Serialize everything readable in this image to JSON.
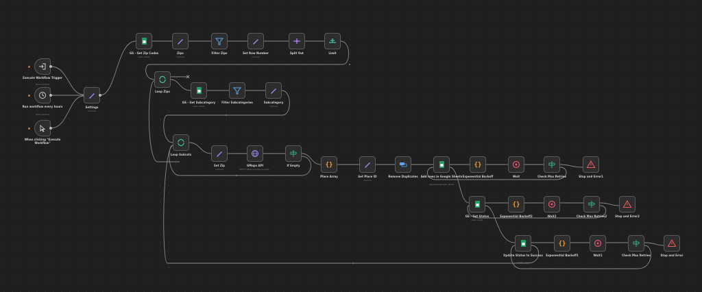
{
  "colors": {
    "background": "#1f1f1f",
    "node_fill": "#2d2d2d",
    "node_border": "#5a5a5a",
    "wire": "#8a8a8a",
    "sheets_green": "#1fa463",
    "edit_purple": "#9b8cf5",
    "filter_blue": "#5aa9f0",
    "split_purple": "#b27bf0",
    "limit_teal": "#41c4a6",
    "code_orange": "#f0a12f",
    "wait_red": "#e8556e",
    "if_green": "#36b37e",
    "error_red": "#ea5b5b",
    "trigger_dot": "#e0683b"
  },
  "nodes": [
    {
      "id": "execute-workflow-trigger",
      "label": "Execute Workflow Trigger",
      "sub": "(Deactivated)",
      "icon": "sign-in-icon",
      "trigger": true
    },
    {
      "id": "run-every-hours",
      "label": "Run workflow every hours",
      "sub": "(Deactivated)",
      "icon": "clock-icon",
      "trigger": true
    },
    {
      "id": "when-clicking-execute",
      "label": "When clicking \"Execute Workflow\"",
      "sub": "",
      "icon": "cursor-icon",
      "trigger": true
    },
    {
      "id": "settings",
      "label": "Settings",
      "sub": "manual",
      "icon": "pencil-icon"
    },
    {
      "id": "gs-get-zip-codes",
      "label": "GS - Get Zip Codes",
      "sub": "read: sheet",
      "icon": "sheets-icon"
    },
    {
      "id": "zips",
      "label": "Zips",
      "sub": "manual",
      "icon": "pencil-icon"
    },
    {
      "id": "filter-zips",
      "label": "Filter Zips",
      "sub": "",
      "icon": "filter-icon"
    },
    {
      "id": "set-row-number",
      "label": "Set Row Number",
      "sub": "manual",
      "icon": "pencil-icon"
    },
    {
      "id": "split-out",
      "label": "Split Out",
      "sub": "",
      "icon": "split-icon"
    },
    {
      "id": "limit",
      "label": "Limit",
      "sub": "",
      "icon": "limit-icon"
    },
    {
      "id": "loop-zips",
      "label": "Loop Zips",
      "sub": "",
      "icon": "loop-icon"
    },
    {
      "id": "gs-get-subcategory",
      "label": "GS - Get Subcategory",
      "sub": "read: sheet",
      "icon": "sheets-icon"
    },
    {
      "id": "filter-subcategories",
      "label": "Filter Subcategories",
      "sub": "",
      "icon": "filter-icon"
    },
    {
      "id": "subcategory",
      "label": "Subcategory",
      "sub": "manual",
      "icon": "pencil-icon"
    },
    {
      "id": "loop-subcats",
      "label": "Loop Subcats",
      "sub": "",
      "icon": "loop-icon"
    },
    {
      "id": "set-zip",
      "label": "Set Zip",
      "sub": "manual",
      "icon": "pencil-icon"
    },
    {
      "id": "gmaps-api",
      "label": "GMaps API",
      "sub": "POST: https://places.googlea...",
      "icon": "globe-icon"
    },
    {
      "id": "if-empty",
      "label": "If Empty",
      "sub": "",
      "icon": "if-icon"
    },
    {
      "id": "place-array",
      "label": "Place Array",
      "sub": "",
      "icon": "code-icon"
    },
    {
      "id": "set-place-id",
      "label": "Set Place ID",
      "sub": "manual",
      "icon": "pencil-icon"
    },
    {
      "id": "remove-duplicates",
      "label": "Remove Duplicates",
      "sub": "",
      "icon": "dedupe-icon"
    },
    {
      "id": "add-rows-sheets",
      "label": "Add rows in Google Sheets",
      "sub": "appendOrUpdate: sheet",
      "icon": "sheets-icon"
    },
    {
      "id": "exponential-backoff",
      "label": "Exponential Backoff",
      "sub": "",
      "icon": "code-icon"
    },
    {
      "id": "wait",
      "label": "Wait",
      "sub": "",
      "icon": "wait-icon"
    },
    {
      "id": "check-max-retries",
      "label": "Check Max Retries",
      "sub": "",
      "icon": "if-icon"
    },
    {
      "id": "stop-and-error1",
      "label": "Stop and Error1",
      "sub": "",
      "icon": "warning-icon"
    },
    {
      "id": "gs-get-status",
      "label": "GS - Get Status",
      "sub": "read: sheet",
      "icon": "sheets-icon"
    },
    {
      "id": "exponential-backoff2",
      "label": "Exponential Backoff2",
      "sub": "",
      "icon": "code-icon"
    },
    {
      "id": "wait2",
      "label": "Wait2",
      "sub": "",
      "icon": "wait-icon"
    },
    {
      "id": "check-max-retries2",
      "label": "Check Max Retries2",
      "sub": "",
      "icon": "if-icon"
    },
    {
      "id": "stop-and-error2",
      "label": "Stop and Error2",
      "sub": "",
      "icon": "warning-icon"
    },
    {
      "id": "update-status-success",
      "label": "Update Status to Success",
      "sub": "update: sheet",
      "icon": "sheets-icon"
    },
    {
      "id": "exponential-backoff1",
      "label": "Exponential Backoff1",
      "sub": "",
      "icon": "code-icon"
    },
    {
      "id": "wait1",
      "label": "Wait1",
      "sub": "",
      "icon": "wait-icon"
    },
    {
      "id": "check-max-retries1",
      "label": "Check Max Retries",
      "sub": "",
      "icon": "if-icon"
    },
    {
      "id": "stop-and-error",
      "label": "Stop and Error",
      "sub": "",
      "icon": "warning-icon"
    }
  ]
}
